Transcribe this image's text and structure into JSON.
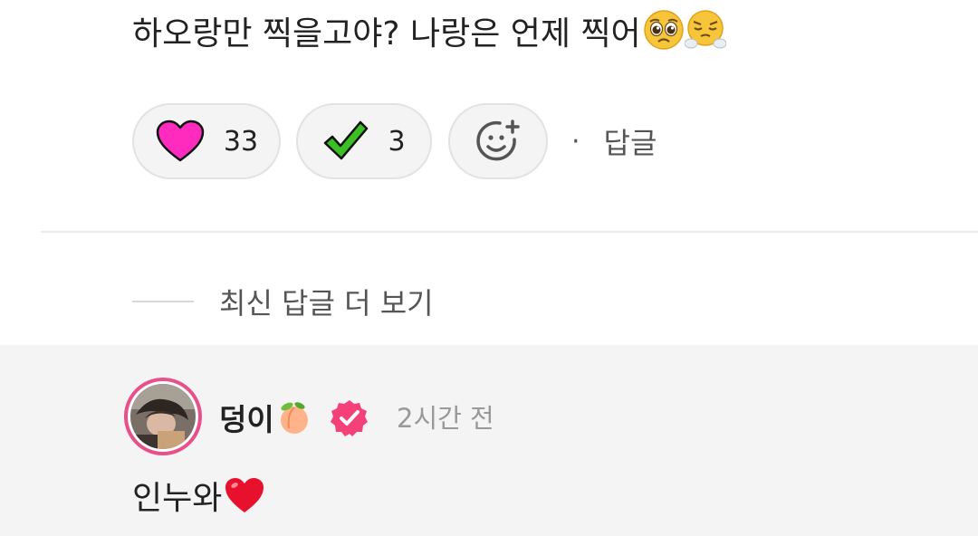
{
  "comment": {
    "text": "하오랑만 찍을고야? 나랑은 언제 찍어",
    "emojis": [
      "pleading-face",
      "face-with-steam"
    ]
  },
  "reactions": [
    {
      "icon": "pink-heart-icon",
      "count": "33",
      "color": "#ff2bbf"
    },
    {
      "icon": "green-check-icon",
      "count": "3",
      "color": "#3bbf22"
    }
  ],
  "actions": {
    "add_reaction_icon": "add-emoji-icon",
    "separator": "·",
    "reply_label": "답글"
  },
  "more_replies": {
    "label": "최신 답글 더 보기"
  },
  "reply": {
    "username": "덩이",
    "username_emoji": "peach",
    "verified": true,
    "verified_color": "#f4417a",
    "time": "2시간 전",
    "text": "인누와",
    "text_emoji": "red-heart",
    "avatar_ring_color": "#e8508a"
  }
}
